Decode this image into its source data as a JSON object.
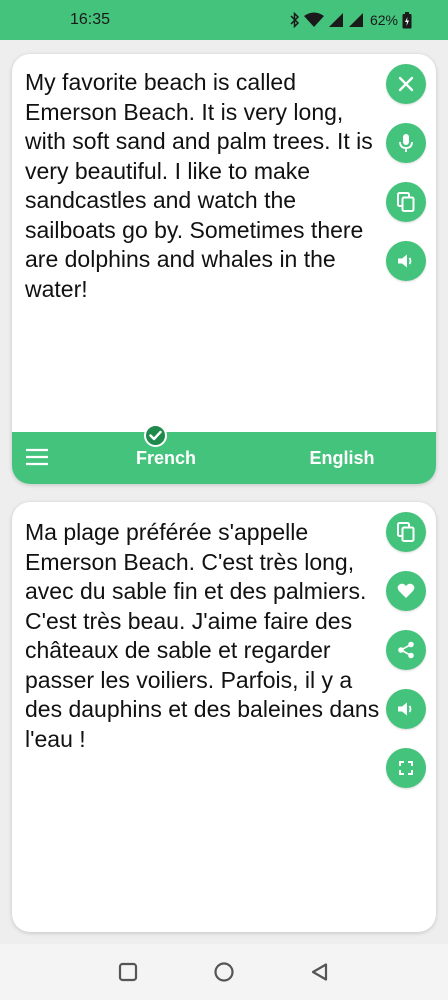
{
  "status_bar": {
    "time": "16:35",
    "battery": "62%",
    "icons": [
      "bluetooth-icon",
      "wifi-icon",
      "signal-icon",
      "signal-icon",
      "battery-icon"
    ]
  },
  "source": {
    "text": "My favorite beach is called Emerson Beach. It is very long, with soft sand and palm trees. It is very beautiful. I like to make sandcastles and watch the sailboats go by. Sometimes there are dolphins and whales in the water!",
    "actions": [
      "close-icon",
      "microphone-icon",
      "copy-icon",
      "speaker-icon"
    ]
  },
  "language_bar": {
    "source_language": "French",
    "target_language": "English",
    "menu_icon": "menu-icon",
    "selected_icon": "check-icon"
  },
  "translation": {
    "text": "Ma plage préférée s'appelle Emerson Beach. C'est très long, avec du sable fin et des palmiers. C'est très beau. J'aime faire des châteaux de sable et regarder passer les voiliers. Parfois, il y a des dauphins et des baleines dans l'eau !",
    "actions": [
      "copy-icon",
      "heart-icon",
      "share-icon",
      "speaker-icon",
      "fullscreen-icon"
    ]
  },
  "colors": {
    "accent": "#44c37c",
    "badge": "#1f8a4c"
  },
  "nav_bar": {
    "icons": [
      "recent-apps-icon",
      "home-icon",
      "back-icon"
    ]
  }
}
